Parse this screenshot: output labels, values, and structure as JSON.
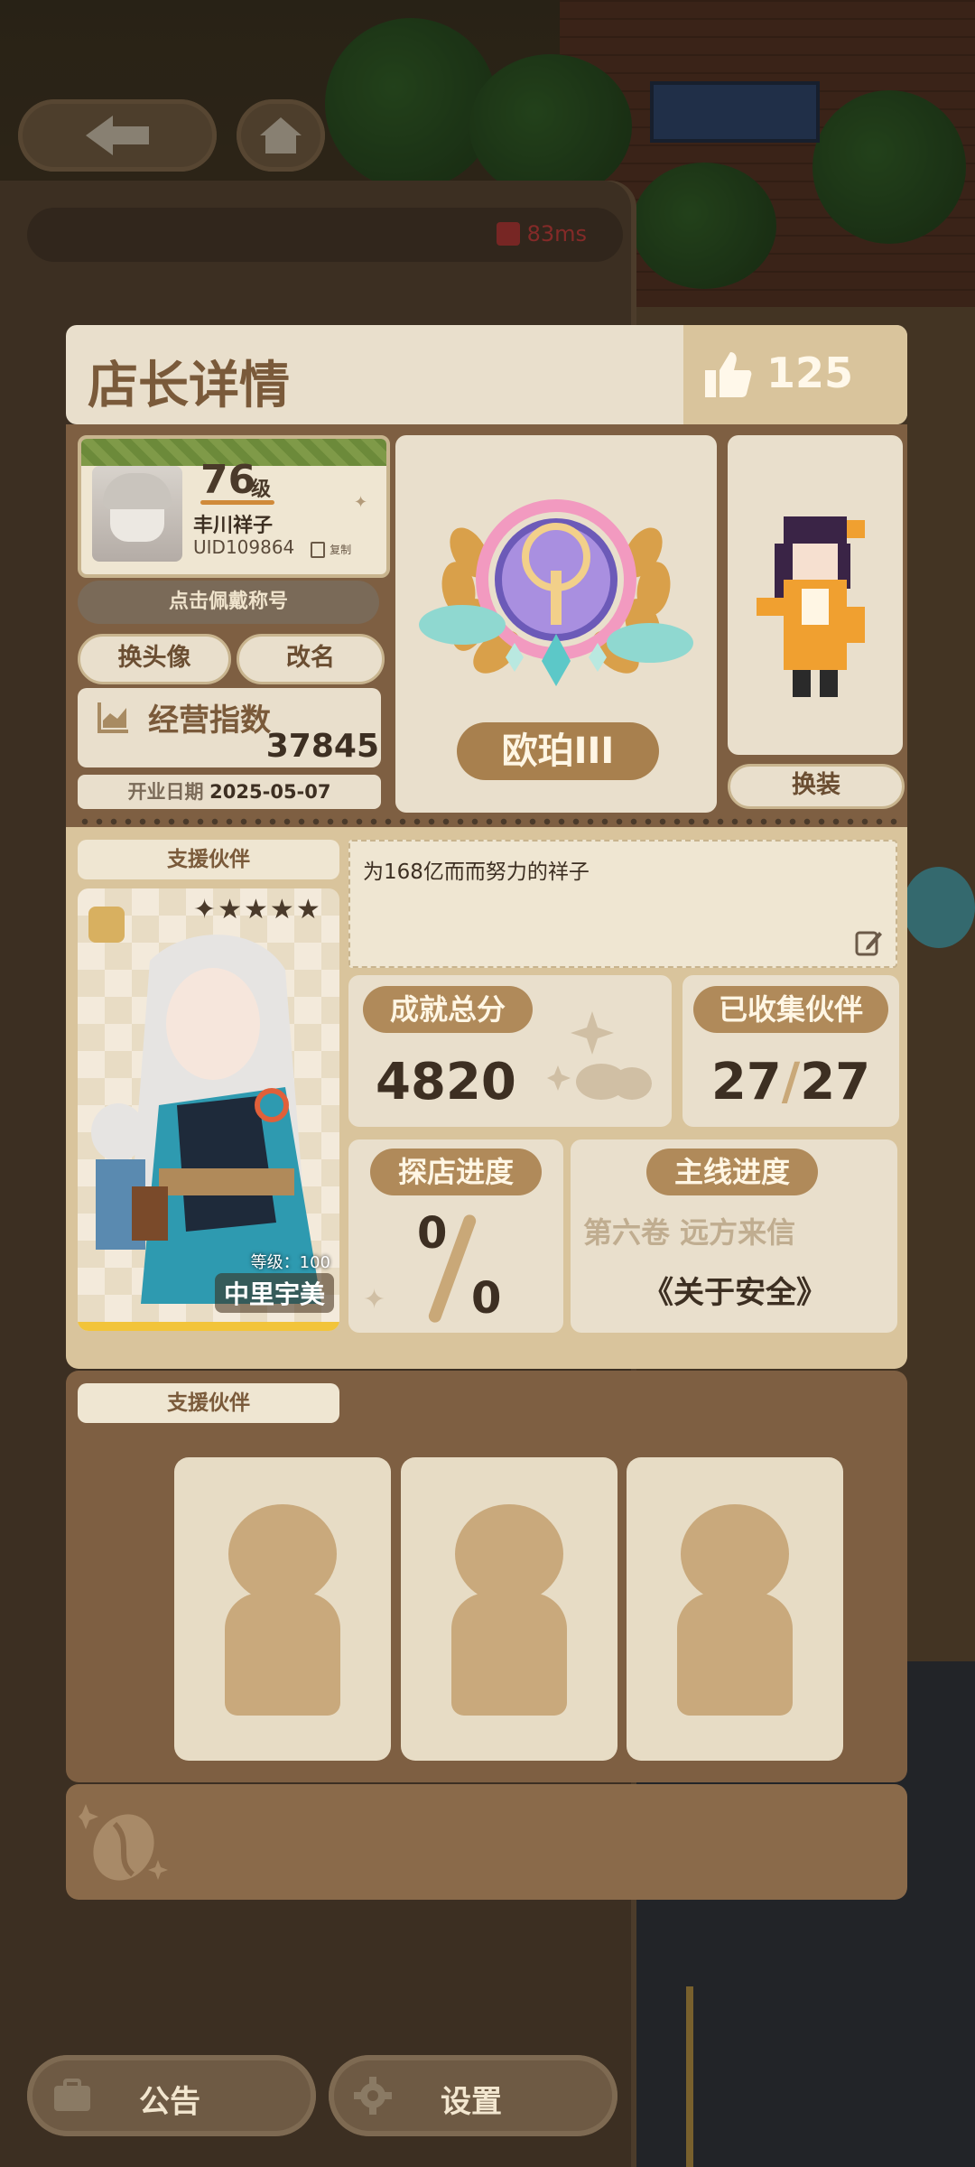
{
  "top": {
    "ping": "83ms"
  },
  "modal": {
    "title": "店长详情",
    "likes": "125",
    "profile": {
      "level_num": "76",
      "level_unit": "级",
      "name": "丰川祥子",
      "uid": "UID109864",
      "copy_label": "复制",
      "title_button": "点击佩戴称号",
      "change_avatar": "换头像",
      "rename": "改名",
      "business_index_label": "经营指数",
      "business_index_value": "37845",
      "open_date_label": "开业日期",
      "open_date_value": "2025-05-07"
    },
    "rank_badge": {
      "label": "欧珀III"
    },
    "character": {
      "change_outfit": "换装"
    },
    "partner": {
      "label": "支援伙伴",
      "stars": "✦★★★★",
      "level_label": "等级：",
      "level_value": "100",
      "name": "中里宇美"
    },
    "signature": "为168亿而而努力的祥子",
    "achievement": {
      "label": "成就总分",
      "value": "4820"
    },
    "collected": {
      "label": "已收集伙伴",
      "owned": "27",
      "separator": "/",
      "total": "27"
    },
    "explore": {
      "label": "探店进度",
      "done": "0",
      "total": "0"
    },
    "mainline": {
      "label": "主线进度",
      "volume": "第六卷 远方来信",
      "chapter": "《关于安全》"
    },
    "support_section": {
      "label": "支援伙伴"
    }
  },
  "bottom": {
    "notice": "公告",
    "settings": "设置"
  },
  "colors": {
    "panel": "#e9dfcc",
    "accent": "#b08a5a",
    "frame": "#7e5f42",
    "title_text": "#7a5a3a"
  }
}
